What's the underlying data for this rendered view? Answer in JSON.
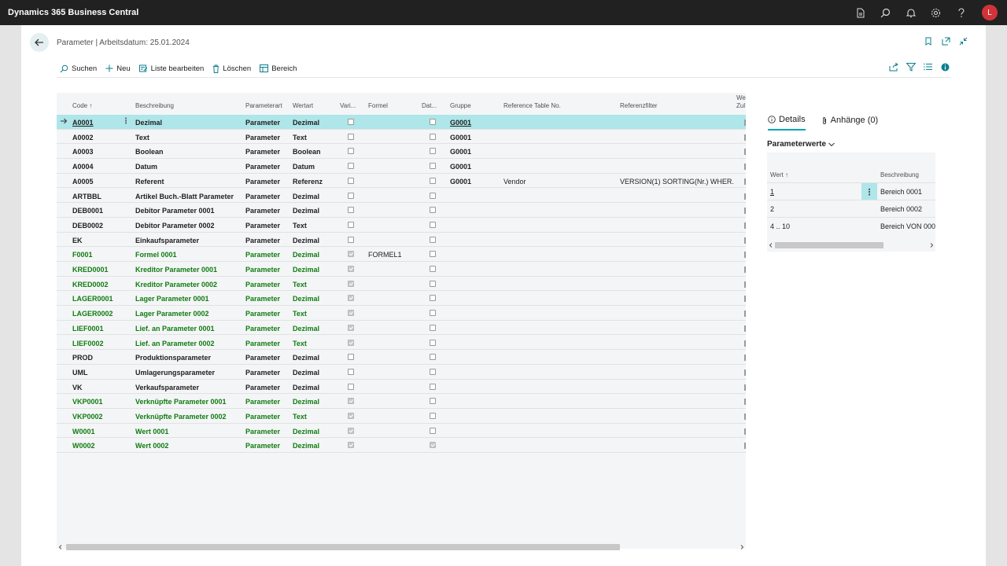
{
  "app": {
    "title": "Dynamics 365 Business Central",
    "avatar_initial": "L",
    "icons": [
      "document-icon",
      "search-icon",
      "bell-icon",
      "gear-icon",
      "help-icon"
    ]
  },
  "page": {
    "title": "Parameter | Arbeitsdatum: 25.01.2024"
  },
  "actions": {
    "search": "Suchen",
    "new": "Neu",
    "edit_list": "Liste bearbeiten",
    "delete": "Löschen",
    "range": "Bereich"
  },
  "columns": {
    "code": "Code ↑",
    "description": "Beschreibung",
    "param_type": "Parameterart",
    "value_type": "Wertart",
    "variable": "Vari...",
    "formula": "Formel",
    "date": "Dat...",
    "group": "Gruppe",
    "ref_table": "Reference Table No.",
    "ref_filter": "Referenzfilter",
    "extra_line1": "We",
    "extra_line2": "Zul"
  },
  "rows": [
    {
      "code": "A0001",
      "description": "Dezimal",
      "param_type": "Parameter",
      "value_type": "Dezimal",
      "variable": false,
      "formula": "",
      "date": false,
      "group": "G0001",
      "ref_table": "",
      "ref_filter": "",
      "style": "selected"
    },
    {
      "code": "A0002",
      "description": "Text",
      "param_type": "Parameter",
      "value_type": "Text",
      "variable": false,
      "formula": "",
      "date": false,
      "group": "G0001",
      "ref_table": "",
      "ref_filter": "",
      "style": "normal"
    },
    {
      "code": "A0003",
      "description": "Boolean",
      "param_type": "Parameter",
      "value_type": "Boolean",
      "variable": false,
      "formula": "",
      "date": false,
      "group": "G0001",
      "ref_table": "",
      "ref_filter": "",
      "style": "normal"
    },
    {
      "code": "A0004",
      "description": "Datum",
      "param_type": "Parameter",
      "value_type": "Datum",
      "variable": false,
      "formula": "",
      "date": false,
      "group": "G0001",
      "ref_table": "",
      "ref_filter": "",
      "style": "normal"
    },
    {
      "code": "A0005",
      "description": "Referent",
      "param_type": "Parameter",
      "value_type": "Referenz",
      "variable": false,
      "formula": "",
      "date": false,
      "group": "G0001",
      "ref_table": "Vendor",
      "ref_filter": "VERSION(1) SORTING(Nr.) WHER...",
      "style": "normal"
    },
    {
      "code": "ARTBBL",
      "description": "Artikel Buch.-Blatt Parameter",
      "param_type": "Parameter",
      "value_type": "Dezimal",
      "variable": false,
      "formula": "",
      "date": false,
      "group": "",
      "ref_table": "",
      "ref_filter": "",
      "style": "normal"
    },
    {
      "code": "DEB0001",
      "description": "Debitor Parameter 0001",
      "param_type": "Parameter",
      "value_type": "Dezimal",
      "variable": false,
      "formula": "",
      "date": false,
      "group": "",
      "ref_table": "",
      "ref_filter": "",
      "style": "normal"
    },
    {
      "code": "DEB0002",
      "description": "Debitor Parameter 0002",
      "param_type": "Parameter",
      "value_type": "Text",
      "variable": false,
      "formula": "",
      "date": false,
      "group": "",
      "ref_table": "",
      "ref_filter": "",
      "style": "normal"
    },
    {
      "code": "EK",
      "description": "Einkaufsparameter",
      "param_type": "Parameter",
      "value_type": "Dezimal",
      "variable": false,
      "formula": "",
      "date": false,
      "group": "",
      "ref_table": "",
      "ref_filter": "",
      "style": "normal"
    },
    {
      "code": "F0001",
      "description": "Formel 0001",
      "param_type": "Parameter",
      "value_type": "Dezimal",
      "variable": true,
      "formula": "FORMEL1",
      "date": false,
      "group": "",
      "ref_table": "",
      "ref_filter": "",
      "style": "green"
    },
    {
      "code": "KRED0001",
      "description": "Kreditor Parameter 0001",
      "param_type": "Parameter",
      "value_type": "Dezimal",
      "variable": true,
      "formula": "",
      "date": false,
      "group": "",
      "ref_table": "",
      "ref_filter": "",
      "style": "green"
    },
    {
      "code": "KRED0002",
      "description": "Kreditor Parameter 0002",
      "param_type": "Parameter",
      "value_type": "Text",
      "variable": true,
      "formula": "",
      "date": false,
      "group": "",
      "ref_table": "",
      "ref_filter": "",
      "style": "green"
    },
    {
      "code": "LAGER0001",
      "description": "Lager Parameter 0001",
      "param_type": "Parameter",
      "value_type": "Dezimal",
      "variable": true,
      "formula": "",
      "date": false,
      "group": "",
      "ref_table": "",
      "ref_filter": "",
      "style": "green"
    },
    {
      "code": "LAGER0002",
      "description": "Lager Parameter 0002",
      "param_type": "Parameter",
      "value_type": "Text",
      "variable": true,
      "formula": "",
      "date": false,
      "group": "",
      "ref_table": "",
      "ref_filter": "",
      "style": "green"
    },
    {
      "code": "LIEF0001",
      "description": "Lief. an Parameter 0001",
      "param_type": "Parameter",
      "value_type": "Dezimal",
      "variable": true,
      "formula": "",
      "date": false,
      "group": "",
      "ref_table": "",
      "ref_filter": "",
      "style": "green"
    },
    {
      "code": "LIEF0002",
      "description": "Lief. an Parameter 0002",
      "param_type": "Parameter",
      "value_type": "Text",
      "variable": true,
      "formula": "",
      "date": false,
      "group": "",
      "ref_table": "",
      "ref_filter": "",
      "style": "green"
    },
    {
      "code": "PROD",
      "description": "Produktionsparameter",
      "param_type": "Parameter",
      "value_type": "Dezimal",
      "variable": false,
      "formula": "",
      "date": false,
      "group": "",
      "ref_table": "",
      "ref_filter": "",
      "style": "normal"
    },
    {
      "code": "UML",
      "description": "Umlagerungsparameter",
      "param_type": "Parameter",
      "value_type": "Dezimal",
      "variable": false,
      "formula": "",
      "date": false,
      "group": "",
      "ref_table": "",
      "ref_filter": "",
      "style": "normal"
    },
    {
      "code": "VK",
      "description": "Verkaufsparameter",
      "param_type": "Parameter",
      "value_type": "Dezimal",
      "variable": false,
      "formula": "",
      "date": false,
      "group": "",
      "ref_table": "",
      "ref_filter": "",
      "style": "normal"
    },
    {
      "code": "VKP0001",
      "description": "Verknüpfte Parameter 0001",
      "param_type": "Parameter",
      "value_type": "Dezimal",
      "variable": true,
      "formula": "",
      "date": false,
      "group": "",
      "ref_table": "",
      "ref_filter": "",
      "style": "green"
    },
    {
      "code": "VKP0002",
      "description": "Verknüpfte Parameter 0002",
      "param_type": "Parameter",
      "value_type": "Text",
      "variable": true,
      "formula": "",
      "date": false,
      "group": "",
      "ref_table": "",
      "ref_filter": "",
      "style": "green"
    },
    {
      "code": "W0001",
      "description": "Wert 0001",
      "param_type": "Parameter",
      "value_type": "Dezimal",
      "variable": true,
      "formula": "",
      "date": false,
      "group": "",
      "ref_table": "",
      "ref_filter": "",
      "style": "green"
    },
    {
      "code": "W0002",
      "description": "Wert 0002",
      "param_type": "Parameter",
      "value_type": "Dezimal",
      "variable": true,
      "formula": "",
      "date": true,
      "group": "",
      "ref_table": "",
      "ref_filter": "",
      "style": "green"
    }
  ],
  "factbox": {
    "tab_details": "Details",
    "tab_attachments": "Anhänge (0)",
    "section_title": "Parameterwerte",
    "col_value": "Wert ↑",
    "col_description": "Beschreibung",
    "rows": [
      {
        "value": "1",
        "description": "Bereich 0001"
      },
      {
        "value": "2",
        "description": "Bereich 0002"
      },
      {
        "value": "4 .. 10",
        "description": "Bereich VON 000"
      }
    ]
  },
  "colors": {
    "accent": "#00a3b4",
    "selected_row": "#aee6e9",
    "green_text": "#107c10",
    "appbar": "#212121",
    "avatar": "#d13438"
  }
}
